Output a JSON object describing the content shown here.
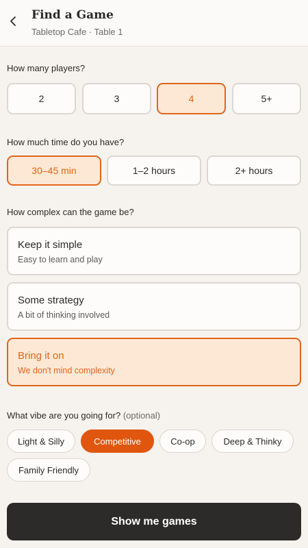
{
  "header": {
    "title": "Find a Game",
    "subtitle": "Tabletop Cafe · Table 1",
    "back_icon": "chevron-left-icon"
  },
  "players": {
    "question": "How many players?",
    "options": [
      "2",
      "3",
      "4",
      "5+"
    ],
    "selected": "4"
  },
  "time": {
    "question": "How much time do you have?",
    "options": [
      "30–45 min",
      "1–2 hours",
      "2+ hours"
    ],
    "selected": "30–45 min"
  },
  "complexity": {
    "question": "How complex can the game be?",
    "options": [
      {
        "title": "Keep it simple",
        "desc": "Easy to learn and play"
      },
      {
        "title": "Some strategy",
        "desc": "A bit of thinking involved"
      },
      {
        "title": "Bring it on",
        "desc": "We don't mind complexity"
      }
    ],
    "selected": "Bring it on"
  },
  "vibe": {
    "question": "What vibe are you going for?",
    "optional_label": "(optional)",
    "options": [
      "Light & Silly",
      "Competitive",
      "Co-op",
      "Deep & Thinky",
      "Family Friendly"
    ],
    "selected": "Competitive"
  },
  "cta": {
    "label": "Show me games"
  },
  "colors": {
    "accent": "#e0651a",
    "accent_bg": "#fde8d6",
    "background": "#f6f3ef",
    "cta_bg": "#2c2b29"
  }
}
